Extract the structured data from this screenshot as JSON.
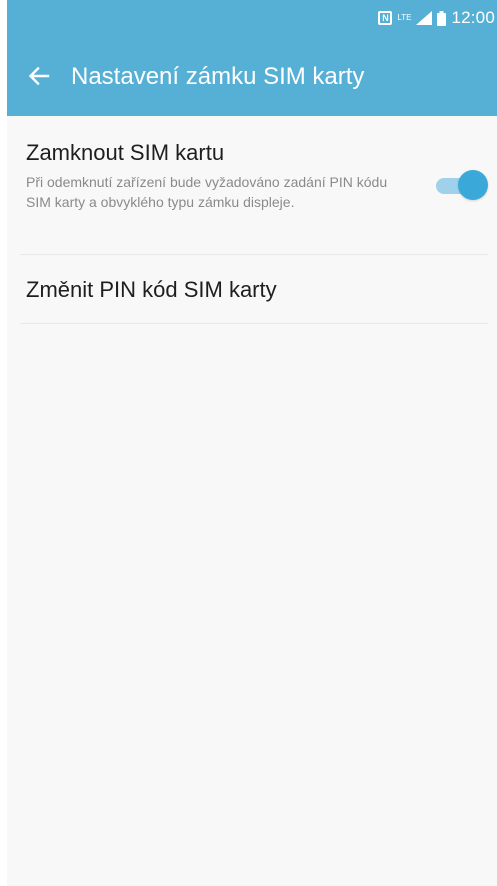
{
  "colors": {
    "accent": "#56b0d6",
    "toggle_thumb": "#3aa9d9",
    "toggle_track": "#9fd2ea",
    "background": "#f8f8f8"
  },
  "status_bar": {
    "icons": [
      "nfc-icon",
      "lte-icon",
      "signal-icon",
      "battery-icon"
    ],
    "lte_label": "LTE",
    "nfc_label": "N",
    "time": "12:00"
  },
  "appbar": {
    "back_icon": "arrow-left-icon",
    "title": "Nastavení zámku SIM karty"
  },
  "settings": {
    "lock_sim": {
      "title": "Zamknout SIM kartu",
      "description": "Při odemknutí zařízení bude vyžadováno zadání PIN kódu SIM karty a obvyklého typu zámku displeje.",
      "enabled": true
    },
    "change_pin": {
      "title": "Změnit PIN kód SIM karty"
    }
  }
}
